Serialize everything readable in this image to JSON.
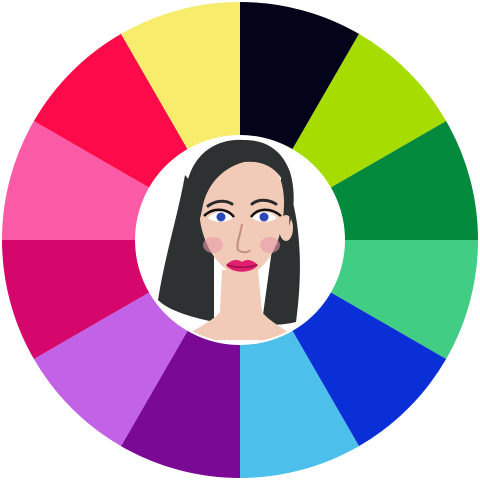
{
  "wheel": {
    "segments": [
      {
        "name": "black",
        "color": "#03031a"
      },
      {
        "name": "lime-green",
        "color": "#a6dc00"
      },
      {
        "name": "dark-green",
        "color": "#038a3c"
      },
      {
        "name": "mint-green",
        "color": "#42cd84"
      },
      {
        "name": "royal-blue",
        "color": "#0a2fd6"
      },
      {
        "name": "sky-blue",
        "color": "#4cc0ea"
      },
      {
        "name": "purple",
        "color": "#7a0a96"
      },
      {
        "name": "lilac",
        "color": "#c262e6"
      },
      {
        "name": "magenta",
        "color": "#d5066c"
      },
      {
        "name": "pink",
        "color": "#fb5aa6"
      },
      {
        "name": "crimson",
        "color": "#fd0a4a"
      },
      {
        "name": "yellow",
        "color": "#f7ec6c"
      }
    ],
    "center_color": "#ffffff"
  },
  "portrait": {
    "hair_color": "#2e3131",
    "skin_color": "#f2cbb8",
    "lip_color": "#e0206e",
    "eye_color": "#2a48b8",
    "blush_color": "#e89aa8"
  }
}
